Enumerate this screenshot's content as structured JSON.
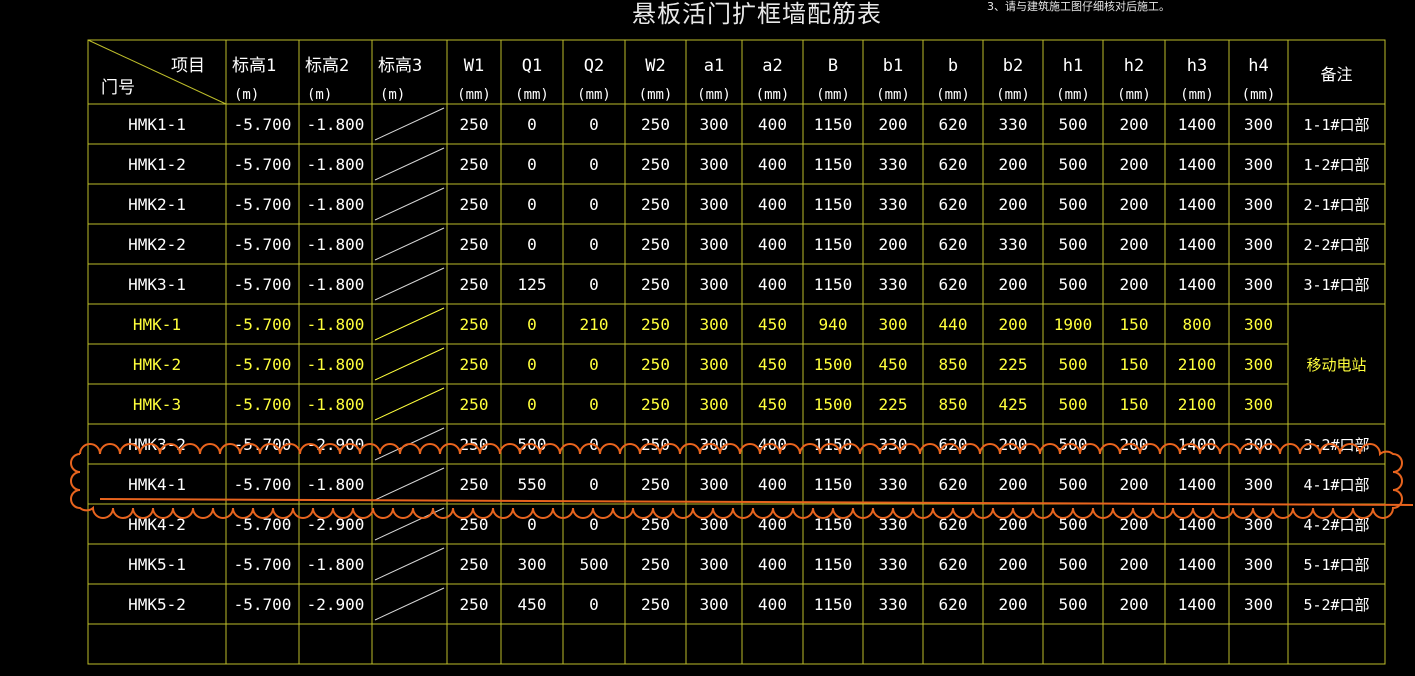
{
  "title": "悬板活门扩框墙配筋表",
  "note": "3、请与建筑施工图仔细核对后施工。",
  "header": {
    "corner_top": "项目",
    "corner_bottom": "门号",
    "columns": [
      {
        "name": "标高1",
        "unit": "(m)"
      },
      {
        "name": "标高2",
        "unit": "(m)"
      },
      {
        "name": "标高3",
        "unit": "(m)"
      },
      {
        "name": "W1",
        "unit": "(mm)"
      },
      {
        "name": "Q1",
        "unit": "(mm)"
      },
      {
        "name": "Q2",
        "unit": "(mm)"
      },
      {
        "name": "W2",
        "unit": "(mm)"
      },
      {
        "name": "a1",
        "unit": "(mm)"
      },
      {
        "name": "a2",
        "unit": "(mm)"
      },
      {
        "name": "B",
        "unit": "(mm)"
      },
      {
        "name": "b1",
        "unit": "(mm)"
      },
      {
        "name": "b",
        "unit": "(mm)"
      },
      {
        "name": "b2",
        "unit": "(mm)"
      },
      {
        "name": "h1",
        "unit": "(mm)"
      },
      {
        "name": "h2",
        "unit": "(mm)"
      },
      {
        "name": "h3",
        "unit": "(mm)"
      },
      {
        "name": "h4",
        "unit": "(mm)"
      }
    ],
    "remark": "备注"
  },
  "rows": [
    {
      "door": "HMK1-1",
      "values": [
        "-5.700",
        "-1.800",
        "",
        "250",
        "0",
        "0",
        "250",
        "300",
        "400",
        "1150",
        "200",
        "620",
        "330",
        "500",
        "200",
        "1400",
        "300"
      ],
      "remark": "1-1#口部",
      "style": "white"
    },
    {
      "door": "HMK1-2",
      "values": [
        "-5.700",
        "-1.800",
        "",
        "250",
        "0",
        "0",
        "250",
        "300",
        "400",
        "1150",
        "330",
        "620",
        "200",
        "500",
        "200",
        "1400",
        "300"
      ],
      "remark": "1-2#口部",
      "style": "white"
    },
    {
      "door": "HMK2-1",
      "values": [
        "-5.700",
        "-1.800",
        "",
        "250",
        "0",
        "0",
        "250",
        "300",
        "400",
        "1150",
        "330",
        "620",
        "200",
        "500",
        "200",
        "1400",
        "300"
      ],
      "remark": "2-1#口部",
      "style": "white"
    },
    {
      "door": "HMK2-2",
      "values": [
        "-5.700",
        "-1.800",
        "",
        "250",
        "0",
        "0",
        "250",
        "300",
        "400",
        "1150",
        "200",
        "620",
        "330",
        "500",
        "200",
        "1400",
        "300"
      ],
      "remark": "2-2#口部",
      "style": "white"
    },
    {
      "door": "HMK3-1",
      "values": [
        "-5.700",
        "-1.800",
        "",
        "250",
        "125",
        "0",
        "250",
        "300",
        "400",
        "1150",
        "330",
        "620",
        "200",
        "500",
        "200",
        "1400",
        "300"
      ],
      "remark": "3-1#口部",
      "style": "white"
    },
    {
      "door": "HMK-1",
      "values": [
        "-5.700",
        "-1.800",
        "",
        "250",
        "0",
        "210",
        "250",
        "300",
        "450",
        "940",
        "300",
        "440",
        "200",
        "1900",
        "150",
        "800",
        "300"
      ],
      "remark": "",
      "style": "yellow"
    },
    {
      "door": "HMK-2",
      "values": [
        "-5.700",
        "-1.800",
        "",
        "250",
        "0",
        "0",
        "250",
        "300",
        "450",
        "1500",
        "450",
        "850",
        "225",
        "500",
        "150",
        "2100",
        "300"
      ],
      "remark": "",
      "style": "yellow"
    },
    {
      "door": "HMK-3",
      "values": [
        "-5.700",
        "-1.800",
        "",
        "250",
        "0",
        "0",
        "250",
        "300",
        "450",
        "1500",
        "225",
        "850",
        "425",
        "500",
        "150",
        "2100",
        "300"
      ],
      "remark": "",
      "style": "yellow"
    },
    {
      "door": "HMK3-2",
      "values": [
        "-5.700",
        "-2.900",
        "",
        "250",
        "500",
        "0",
        "250",
        "300",
        "400",
        "1150",
        "330",
        "620",
        "200",
        "500",
        "200",
        "1400",
        "300"
      ],
      "remark": "3-2#口部",
      "style": "white"
    },
    {
      "door": "HMK4-1",
      "values": [
        "-5.700",
        "-1.800",
        "",
        "250",
        "550",
        "0",
        "250",
        "300",
        "400",
        "1150",
        "330",
        "620",
        "200",
        "500",
        "200",
        "1400",
        "300"
      ],
      "remark": "4-1#口部",
      "style": "white"
    },
    {
      "door": "HMK4-2",
      "values": [
        "-5.700",
        "-2.900",
        "",
        "250",
        "0",
        "0",
        "250",
        "300",
        "400",
        "1150",
        "330",
        "620",
        "200",
        "500",
        "200",
        "1400",
        "300"
      ],
      "remark": "4-2#口部",
      "style": "white"
    },
    {
      "door": "HMK5-1",
      "values": [
        "-5.700",
        "-1.800",
        "",
        "250",
        "300",
        "500",
        "250",
        "300",
        "400",
        "1150",
        "330",
        "620",
        "200",
        "500",
        "200",
        "1400",
        "300"
      ],
      "remark": "5-1#口部",
      "style": "white"
    },
    {
      "door": "HMK5-2",
      "values": [
        "-5.700",
        "-2.900",
        "",
        "250",
        "450",
        "0",
        "250",
        "300",
        "400",
        "1150",
        "330",
        "620",
        "200",
        "500",
        "200",
        "1400",
        "300"
      ],
      "remark": "5-2#口部",
      "style": "white"
    },
    {
      "door": "",
      "values": [
        "",
        "",
        "",
        "",
        "",
        "",
        "",
        "",
        "",
        "",
        "",
        "",
        "",
        "",
        "",
        "",
        ""
      ],
      "remark": "",
      "style": "white"
    }
  ],
  "merged_remark": "移动电站",
  "colors": {
    "background": "#000000",
    "grid": "#bdbd2a",
    "white_text": "#ffffff",
    "yellow_text": "#ffff3c",
    "cloud": "#e8641e"
  }
}
